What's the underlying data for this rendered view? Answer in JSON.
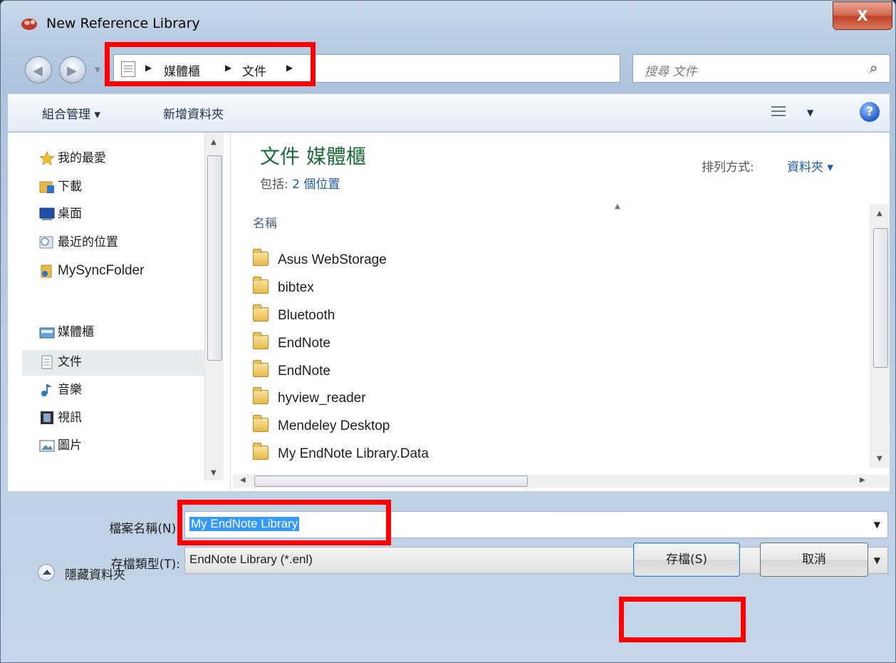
{
  "window": {
    "title": "New Reference Library",
    "close_symbol": "X"
  },
  "address": {
    "crumbs": [
      "媒體櫃",
      "文件"
    ],
    "search_placeholder": "搜尋 文件"
  },
  "toolbar": {
    "organize": "組合管理 ▾",
    "new_folder": "新增資料夾"
  },
  "navigation": {
    "favorites": {
      "label": "我的最愛",
      "items": [
        "下載",
        "桌面",
        "最近的位置",
        "MySyncFolder"
      ]
    },
    "libraries": {
      "label": "媒體櫃",
      "items": [
        "文件",
        "音樂",
        "視訊",
        "圖片"
      ]
    },
    "selected": "文件"
  },
  "library": {
    "title": "文件 媒體櫃",
    "includes_label": "包括:",
    "includes_value": "2 個位置",
    "arrange_label": "排列方式:",
    "arrange_value": "資料夾 ▾"
  },
  "file_list": {
    "column_name": "名稱",
    "items": [
      "Asus WebStorage",
      "bibtex",
      "Bluetooth",
      "EndNote",
      "EndNote",
      "hyview_reader",
      "Mendeley Desktop",
      "My EndNote Library.Data"
    ]
  },
  "save": {
    "filename_label": "檔案名稱(N):",
    "filename_value": "My EndNote Library",
    "filetype_label": "存檔類型(T):",
    "filetype_value": "EndNote Library (*.enl)",
    "save_button": "存檔(S)",
    "cancel_button": "取消",
    "hide_folders": "隱藏資料夾"
  },
  "colors": {
    "highlight": "#ff0000",
    "library_title": "#1e6a3a",
    "link": "#1e5aa6",
    "selection": "#3399ff"
  }
}
